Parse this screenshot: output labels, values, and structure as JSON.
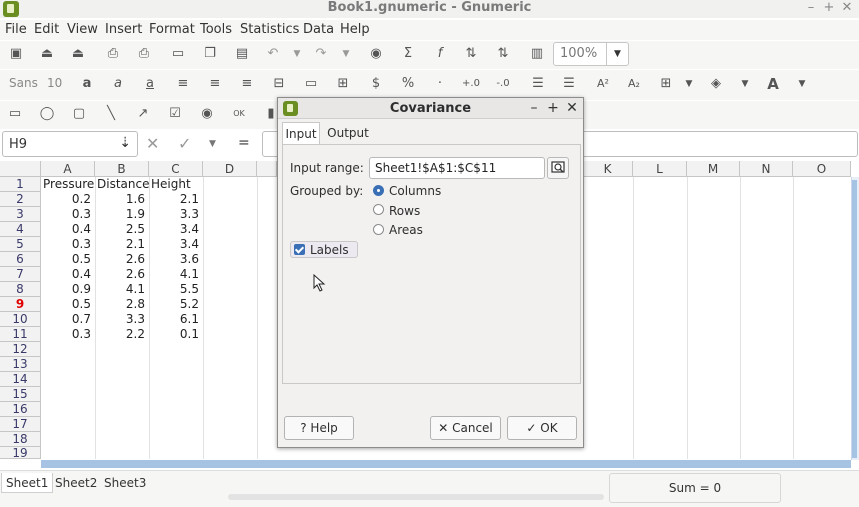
{
  "window": {
    "title": "Book1.gnumeric - Gnumeric",
    "minimize": "–",
    "maximize": "+",
    "close": "✕"
  },
  "menu": [
    "File",
    "Edit",
    "View",
    "Insert",
    "Format",
    "Tools",
    "Statistics",
    "Data",
    "Help"
  ],
  "toolbar": {
    "zoom": "100%",
    "font_name": "Sans",
    "font_size": "10"
  },
  "formula_bar": {
    "cell_ref": "H9",
    "equals": "="
  },
  "sheet": {
    "columns": [
      "A",
      "B",
      "C",
      "D",
      "K",
      "L",
      "M",
      "N",
      "O"
    ],
    "rows": [
      "1",
      "2",
      "3",
      "4",
      "5",
      "6",
      "7",
      "8",
      "9",
      "10",
      "11",
      "12",
      "13",
      "14",
      "15",
      "16",
      "17",
      "18",
      "19"
    ],
    "active_row": "9",
    "headers": [
      "Pressure",
      "Distance",
      "Height"
    ],
    "data": [
      [
        "0.2",
        "1.6",
        "2.1"
      ],
      [
        "0.3",
        "1.9",
        "3.3"
      ],
      [
        "0.4",
        "2.5",
        "3.4"
      ],
      [
        "0.3",
        "2.1",
        "3.4"
      ],
      [
        "0.5",
        "2.6",
        "3.6"
      ],
      [
        "0.4",
        "2.6",
        "4.1"
      ],
      [
        "0.9",
        "4.1",
        "5.5"
      ],
      [
        "0.5",
        "2.8",
        "5.2"
      ],
      [
        "0.7",
        "3.3",
        "6.1"
      ],
      [
        "0.3",
        "2.2",
        "0.1"
      ]
    ]
  },
  "status": {
    "tabs": [
      "Sheet1",
      "Sheet2",
      "Sheet3"
    ],
    "sum": "Sum = 0"
  },
  "dialog": {
    "title": "Covariance",
    "minimize": "–",
    "maximize": "+",
    "close": "✕",
    "tabs": [
      "Input",
      "Output"
    ],
    "input_range_label": "Input range:",
    "input_range_value": "Sheet1!$A$1:$C$11",
    "grouped_by_label": "Grouped by:",
    "grouped_options": [
      "Columns",
      "Rows",
      "Areas"
    ],
    "grouped_selected": "Columns",
    "labels_label": "Labels",
    "labels_checked": true,
    "help_button": "Help",
    "cancel_button": "Cancel",
    "ok_button": "OK"
  },
  "colors": {
    "accent": "#3a6fb5",
    "active_row": "#e00000",
    "app_icon": "#6b8e23"
  }
}
